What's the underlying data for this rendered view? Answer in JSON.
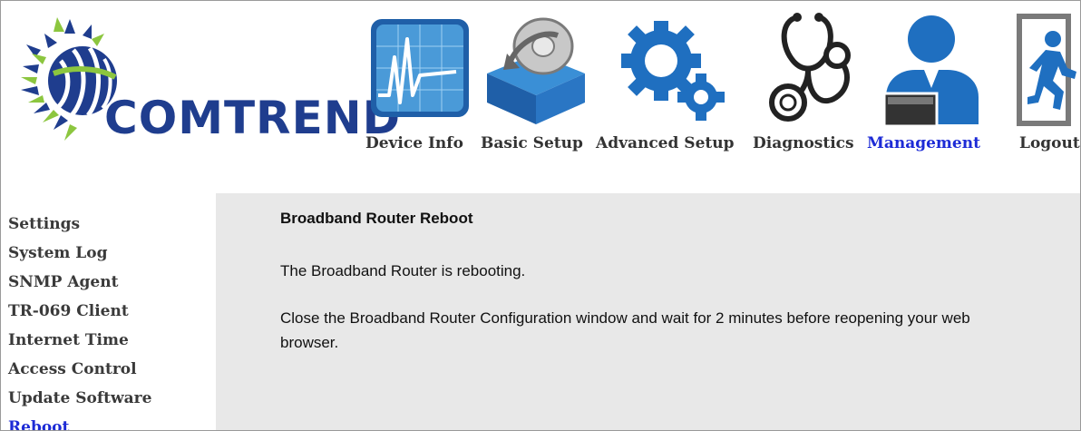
{
  "brand": {
    "logo_text": "COMTREND"
  },
  "nav": {
    "items": [
      {
        "label": "Device Info",
        "icon": "device-info-icon"
      },
      {
        "label": "Basic Setup",
        "icon": "basic-setup-icon"
      },
      {
        "label": "Advanced Setup",
        "icon": "advanced-setup-icon"
      },
      {
        "label": "Diagnostics",
        "icon": "diagnostics-icon"
      },
      {
        "label": "Management",
        "icon": "management-icon",
        "active": true
      },
      {
        "label": "Logout",
        "icon": "logout-icon"
      }
    ]
  },
  "sidebar": {
    "items": [
      {
        "label": "Settings"
      },
      {
        "label": "System Log"
      },
      {
        "label": "SNMP Agent"
      },
      {
        "label": "TR-069 Client"
      },
      {
        "label": "Internet Time"
      },
      {
        "label": "Access Control"
      },
      {
        "label": "Update Software"
      },
      {
        "label": "Reboot",
        "active": true
      }
    ]
  },
  "main": {
    "title": "Broadband Router Reboot",
    "message": "The Broadband Router is rebooting.",
    "instruction": "Close the Broadband Router Configuration window and wait for 2 minutes before reopening your web browser."
  },
  "colors": {
    "brand_blue": "#1f3d8e",
    "active_link": "#1d2bd6",
    "content_bg": "#e8e8e8",
    "link_text": "#333333"
  }
}
